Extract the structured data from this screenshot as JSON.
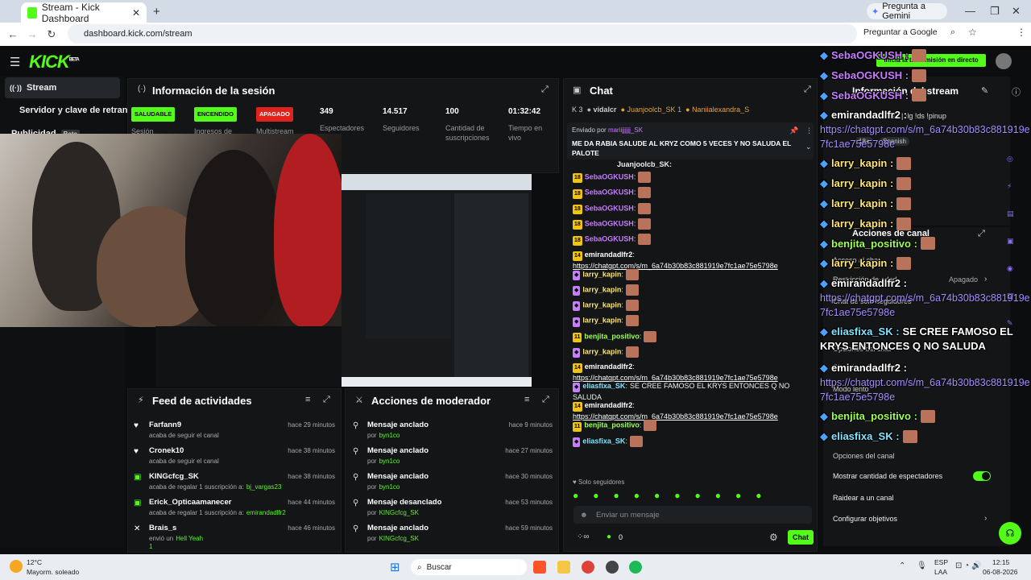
{
  "browser": {
    "tab_title": "Stream - Kick Dashboard",
    "new_tab": "+",
    "gemini": "Pregunta a Gemini",
    "url": "dashboard.kick.com/stream",
    "ask_google": "Preguntar a Google",
    "close_tab": "✕"
  },
  "app": {
    "logo": "KICK",
    "logo_sup": "BETA"
  },
  "sidebar": {
    "items": [
      {
        "label": "Stream"
      },
      {
        "label": "Servidor y clave de retransmi"
      },
      {
        "label": "Publicidad",
        "badge": "Beta"
      }
    ]
  },
  "session": {
    "title": "Información de la sesión",
    "stats": [
      {
        "pill": "SALUDABLE",
        "label": "Sesión"
      },
      {
        "pill": "ENCENDIDO",
        "label": "Ingresos de"
      },
      {
        "pill": "APAGADO",
        "label": "Multistream"
      },
      {
        "value": "349",
        "label": "Espectadores"
      },
      {
        "value": "14.517",
        "label": "Seguidores"
      },
      {
        "value": "100",
        "label": "Cantidad de suscripciones"
      },
      {
        "value": "01:32:42",
        "label": "Tiempo en vivo"
      }
    ]
  },
  "feed": {
    "title": "Feed de actividades",
    "items": [
      {
        "user": "Farfann9",
        "sub": "acaba de seguir el canal",
        "time": "hace 29 minutos"
      },
      {
        "user": "Cronek10",
        "sub": "acaba de seguir el canal",
        "time": "hace 38 minutos"
      },
      {
        "user": "KINGcfcg_SK",
        "sub": "acaba de regalar 1 suscripción a:",
        "target": "bj_vargas23",
        "time": "hace 38 minutos"
      },
      {
        "user": "Erick_Opticaamanecer",
        "sub": "acaba de regalar 1 suscripción a:",
        "target": "emirandadlfr2",
        "time": "hace 44 minutos"
      },
      {
        "user": "Brais_s",
        "sub": "envió un",
        "target": "Hell Yeah",
        "extra": "1",
        "time": "hace 46 minutos"
      }
    ]
  },
  "modact": {
    "title": "Acciones de moderador",
    "items": [
      {
        "action": "Mensaje anclado",
        "by": "por",
        "mod": "byn1co",
        "time": "hace 9 minutos"
      },
      {
        "action": "Mensaje anclado",
        "by": "por",
        "mod": "byn1co",
        "time": "hace 27 minutos"
      },
      {
        "action": "Mensaje anclado",
        "by": "por",
        "mod": "byn1co",
        "time": "hace 30 minutos"
      },
      {
        "action": "Mensaje desanclado",
        "by": "por",
        "mod": "KINGcfcg_SK",
        "time": "hace 53 minutos"
      },
      {
        "action": "Mensaje anclado",
        "by": "por",
        "mod": "KINGcfcg_SK",
        "time": "hace 59 minutos"
      }
    ]
  },
  "chat": {
    "title": "Chat",
    "top_count": "3",
    "top_users": [
      "vidalcr",
      "Juanjoolcb_SK",
      "1",
      "Naniialexandra_S"
    ],
    "pinned_by_label": "Enviado por",
    "pinned_by": "mariijjjjjj_SK",
    "pinned_text": "ME DA RABIA SALUDE AL KRYZ COMO 5 VECES Y NO SALUDA EL PALOTE",
    "partial_top": "Juanjoolcb_SK:",
    "messages": [
      {
        "lvl": "18",
        "user": "SebaOGKUSH",
        "color": "#c77dff"
      },
      {
        "lvl": "18",
        "user": "SebaOGKUSH",
        "color": "#c77dff"
      },
      {
        "lvl": "18",
        "user": "SebaOGKUSH",
        "color": "#c77dff"
      },
      {
        "lvl": "18",
        "user": "SebaOGKUSH",
        "color": "#c77dff"
      },
      {
        "lvl": "18",
        "user": "SebaOGKUSH",
        "color": "#c77dff"
      },
      {
        "lvl": "14",
        "user": "emirandadlfr2",
        "color": "#ffffff",
        "link": "https://chatgpt.com/s/m_6a74b30b83c881919e7fc1ae75e5798e"
      },
      {
        "lvl": "",
        "user": "larry_kapin",
        "color": "#ffe66d"
      },
      {
        "lvl": "",
        "user": "larry_kapin",
        "color": "#ffe66d"
      },
      {
        "lvl": "",
        "user": "larry_kapin",
        "color": "#ffe66d"
      },
      {
        "lvl": "",
        "user": "larry_kapin",
        "color": "#ffe66d"
      },
      {
        "lvl": "11",
        "user": "benjita_positivo",
        "color": "#9cff57"
      },
      {
        "lvl": "",
        "user": "larry_kapin",
        "color": "#ffe66d"
      },
      {
        "lvl": "14",
        "user": "emirandadlfr2",
        "color": "#ffffff",
        "link": "https://chatgpt.com/s/m_6a74b30b83c881919e7fc1ae75e5798e"
      },
      {
        "lvl": "",
        "user": "eliasfixa_SK",
        "color": "#7ee6ff",
        "text": "SE CREE FAMOSO EL KRYS ENTONCES Q NO SALUDA"
      },
      {
        "lvl": "14",
        "user": "emirandadlfr2",
        "color": "#ffffff",
        "link": "https://chatgpt.com/s/m_6a74b30b83c881919e7fc1ae75e5798e"
      },
      {
        "lvl": "11",
        "user": "benjita_positivo",
        "color": "#9cff57"
      },
      {
        "lvl": "",
        "user": "eliasfixa_SK",
        "color": "#7ee6ff"
      }
    ],
    "followers_only": "Solo seguidores",
    "input_placeholder": "Enviar un mensaje",
    "points": "0",
    "send": "Chat"
  },
  "rightpanel": {
    "stream_info": "Información del stream",
    "stream_title_partial": "rse | !lg !ds !pinup",
    "tag_age": "18+",
    "tag_lang": "Spanish",
    "start_btn": "Inicia la transmisión en directo",
    "canal_actions": "Acciones de canal",
    "chat_access": "Acceso al chat",
    "age_restriction": "Restricción de edad",
    "age_value": "Apagado",
    "followers_chat": "Chat de solo-seguidores",
    "chat_options": "Opciones del chat",
    "followers_chat2": "Chat de solo-emotes",
    "slow_mode": "Modo lento",
    "canal_options": "Opciones del canal",
    "show_viewers": "Mostrar cantidad de espectadores",
    "raid": "Raidear a un canal",
    "goals": "Configurar objetivos"
  },
  "overlay": {
    "lines": [
      {
        "user": "SebaOGKUSH :",
        "color": "#c77dff"
      },
      {
        "user": "SebaOGKUSH :",
        "color": "#c77dff"
      },
      {
        "user": "SebaOGKUSH :",
        "color": "#c77dff"
      },
      {
        "user": "emirandadlfr2 :",
        "color": "#ffffff",
        "link": "https://chatgpt.com/s/m_6a74b30b83c881919e7fc1ae75e5798e"
      },
      {
        "user": "larry_kapin :",
        "color": "#ffe66d"
      },
      {
        "user": "larry_kapin :",
        "color": "#ffe66d"
      },
      {
        "user": "larry_kapin :",
        "color": "#ffe66d"
      },
      {
        "user": "larry_kapin :",
        "color": "#ffe66d"
      },
      {
        "user": "benjita_positivo :",
        "color": "#9cff57"
      },
      {
        "user": "larry_kapin :",
        "color": "#ffe66d"
      },
      {
        "user": "emirandadlfr2 :",
        "color": "#ffffff",
        "link": "https://chatgpt.com/s/m_6a74b30b83c881919e7fc1ae75e5798e"
      },
      {
        "user": "eliasfixa_SK :",
        "color": "#7ee6ff",
        "text": "SE CREE FAMOSO EL KRYS ENTONCES Q NO SALUDA"
      },
      {
        "user": "emirandadlfr2 :",
        "color": "#ffffff",
        "link": "https://chatgpt.com/s/m_6a74b30b83c881919e7fc1ae75e5798e"
      },
      {
        "user": "benjita_positivo :",
        "color": "#9cff57"
      },
      {
        "user": "eliasfixa_SK :",
        "color": "#7ee6ff"
      }
    ]
  },
  "taskbar": {
    "temp": "12°C",
    "weather": "Mayorm. soleado",
    "search": "Buscar",
    "lang1": "ESP",
    "lang2": "LAA",
    "time": "12:15",
    "date": "06-08-2026"
  },
  "colors": {
    "accent": "#53fc18",
    "bg": "#0b0d0e",
    "panel": "#131517"
  }
}
